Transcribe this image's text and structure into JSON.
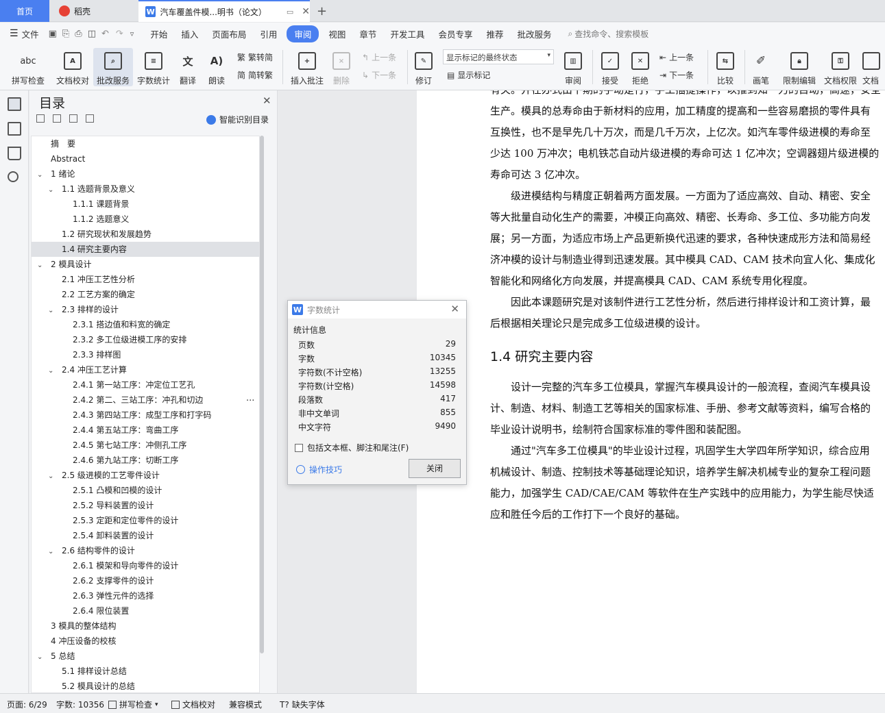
{
  "tabs": {
    "home": "首页",
    "daoke": "稻壳",
    "doc": "汽车覆盖件模...明书（论文）",
    "new_tab": "+"
  },
  "menu": [
    "文件",
    "开始",
    "插入",
    "页面布局",
    "引用",
    "审阅",
    "视图",
    "章节",
    "开发工具",
    "会员专享",
    "推荐",
    "批改服务"
  ],
  "menu_active": "审阅",
  "search_placeholder": "查找命令、搜索模板",
  "ribbon": {
    "spell": "拼写检查",
    "proof": "文档校对",
    "review_service": "批改服务",
    "word_count": "字数统计",
    "translate": "翻译",
    "read": "朗读",
    "trad": "繁转简",
    "simp": "简转繁",
    "insert_comment": "插入批注",
    "delete": "删除",
    "prev": "上一条",
    "next": "下一条",
    "revise": "修订",
    "markup_state": "显示标记的最终状态",
    "show_markup": "显示标记",
    "review": "审阅",
    "accept": "接受",
    "reject": "拒绝",
    "prev2": "上一条",
    "next2": "下一条",
    "compare": "比较",
    "pen": "画笔",
    "restrict": "限制编辑",
    "doc_permission": "文档权限",
    "doc_more": "文档"
  },
  "toc": {
    "title": "目录",
    "smart": "智能识别目录",
    "items": [
      {
        "t": "摘　要",
        "lv": 0,
        "c": ""
      },
      {
        "t": "Abstract",
        "lv": 0,
        "c": ""
      },
      {
        "t": "1  绪论",
        "lv": 0,
        "c": "v"
      },
      {
        "t": "1.1 选题背景及意义",
        "lv": 1,
        "c": "v"
      },
      {
        "t": "1.1.1  课题背景",
        "lv": 2,
        "c": ""
      },
      {
        "t": "1.1.2  选题意义",
        "lv": 2,
        "c": ""
      },
      {
        "t": "1.2  研究现状和发展趋势",
        "lv": 1,
        "c": ""
      },
      {
        "t": "1.4  研究主要内容",
        "lv": 1,
        "c": "",
        "sel": true
      },
      {
        "t": "2  模具设计",
        "lv": 0,
        "c": "v"
      },
      {
        "t": "2.1  冲压工艺性分析",
        "lv": 1,
        "c": ""
      },
      {
        "t": "2.2  工艺方案的确定",
        "lv": 1,
        "c": ""
      },
      {
        "t": "2.3  排样的设计",
        "lv": 1,
        "c": "v"
      },
      {
        "t": "2.3.1  搭边值和料宽的确定",
        "lv": 2,
        "c": ""
      },
      {
        "t": "2.3.2  多工位级进模工序的安排",
        "lv": 2,
        "c": ""
      },
      {
        "t": "2.3.3  排样图",
        "lv": 2,
        "c": ""
      },
      {
        "t": "2.4  冲压工艺计算",
        "lv": 1,
        "c": "v"
      },
      {
        "t": "2.4.1 第一站工序：冲定位工艺孔",
        "lv": 2,
        "c": ""
      },
      {
        "t": "2.4.2 第二、三站工序：冲孔和切边",
        "lv": 2,
        "c": ""
      },
      {
        "t": "2.4.3 第四站工序：成型工序和打字码",
        "lv": 2,
        "c": ""
      },
      {
        "t": "2.4.4 第五站工序：弯曲工序",
        "lv": 2,
        "c": ""
      },
      {
        "t": "2.4.5 第七站工序：冲侧孔工序",
        "lv": 2,
        "c": ""
      },
      {
        "t": "2.4.6 第九站工序：切断工序",
        "lv": 2,
        "c": ""
      },
      {
        "t": "2.5  级进模的工艺零件设计",
        "lv": 1,
        "c": "v"
      },
      {
        "t": "2.5.1  凸模和凹模的设计",
        "lv": 2,
        "c": ""
      },
      {
        "t": "2.5.2  导料装置的设计",
        "lv": 2,
        "c": ""
      },
      {
        "t": "2.5.3  定距和定位零件的设计",
        "lv": 2,
        "c": ""
      },
      {
        "t": "2.5.4  卸料装置的设计",
        "lv": 2,
        "c": ""
      },
      {
        "t": "2.6  结构零件的设计",
        "lv": 1,
        "c": "v"
      },
      {
        "t": "2.6.1  模架和导向零件的设计",
        "lv": 2,
        "c": ""
      },
      {
        "t": "2.6.2  支撑零件的设计",
        "lv": 2,
        "c": ""
      },
      {
        "t": "2.6.3  弹性元件的选择",
        "lv": 2,
        "c": ""
      },
      {
        "t": "2.6.4  限位装置",
        "lv": 2,
        "c": ""
      },
      {
        "t": "3  模具的整体结构",
        "lv": 0,
        "c": ""
      },
      {
        "t": "4  冲压设备的校核",
        "lv": 0,
        "c": ""
      },
      {
        "t": "5  总结",
        "lv": 0,
        "c": "v"
      },
      {
        "t": "5.1  排样设计总结",
        "lv": 1,
        "c": ""
      },
      {
        "t": "5.2  模具设计的总结",
        "lv": 1,
        "c": ""
      }
    ]
  },
  "doc": {
    "lines": [
      "有关。并在办式由下期的手动是行，手工插提操作，以推到知一力的目动，高速，安全",
      "生产。模具的总寿命由于新材料的应用，加工精度的提高和一些容易磨损的零件具有",
      "互换性，也不是早先几十万次，而是几千万次，上亿次。如汽车零件级进模的寿命至",
      "少达 100 万冲次；电机铁芯自动片级进模的寿命可达 1 亿冲次；空调器翅片级进模的",
      "寿命可达 3 亿冲次。",
      "　　级进模结构与精度正朝着两方面发展。一方面为了适应高效、自动、精密、安全",
      "等大批量自动化生产的需要，冲模正向高效、精密、长寿命、多工位、多功能方向发",
      "展；另一方面，为适应市场上产品更新换代迅速的要求，各种快速成形方法和简易经",
      "济冲模的设计与制造业得到迅速发展。其中模具 CAD、CAM 技术向宜人化、集成化",
      "智能化和网络化方向发展，并提高模具 CAD、CAM 系统专用化程度。",
      "　　因此本课题研究是对该制件进行工艺性分析，然后进行排样设计和工资计算，最",
      "后根据相关理论只是完成多工位级进模的设计。"
    ],
    "heading": "1.4  研究主要内容",
    "lines2": [
      "　　设计一完整的汽车多工位模具，掌握汽车模具设计的一般流程，查阅汽车模具设",
      "计、制造、材料、制造工艺等相关的国家标准、手册、参考文献等资料，编写合格的",
      "毕业设计说明书，绘制符合国家标准的零件图和装配图。",
      "　　通过\"汽车多工位模具\"的毕业设计过程，巩固学生大学四年所学知识，综合应用",
      "机械设计、制造、控制技术等基础理论知识，培养学生解决机械专业的复杂工程问题",
      "能力，加强学生 CAD/CAE/CAM 等软件在生产实践中的应用能力，为学生能尽快适",
      "应和胜任今后的工作打下一个良好的基础。"
    ]
  },
  "dialog": {
    "title": "字数统计",
    "section": "统计信息",
    "rows": [
      {
        "k": "页数",
        "v": "29"
      },
      {
        "k": "字数",
        "v": "10345"
      },
      {
        "k": "字符数(不计空格)",
        "v": "13255"
      },
      {
        "k": "字符数(计空格)",
        "v": "14598"
      },
      {
        "k": "段落数",
        "v": "417"
      },
      {
        "k": "非中文单词",
        "v": "855"
      },
      {
        "k": "中文字符",
        "v": "9490"
      }
    ],
    "checkbox": "包括文本框、脚注和尾注(F)",
    "tips": "操作技巧",
    "close": "关闭"
  },
  "status": {
    "page": "页面: 6/29",
    "words": "字数: 10356",
    "spell": "拼写检查",
    "proof": "文档校对",
    "compat": "兼容模式",
    "missing_font": "缺失字体"
  }
}
